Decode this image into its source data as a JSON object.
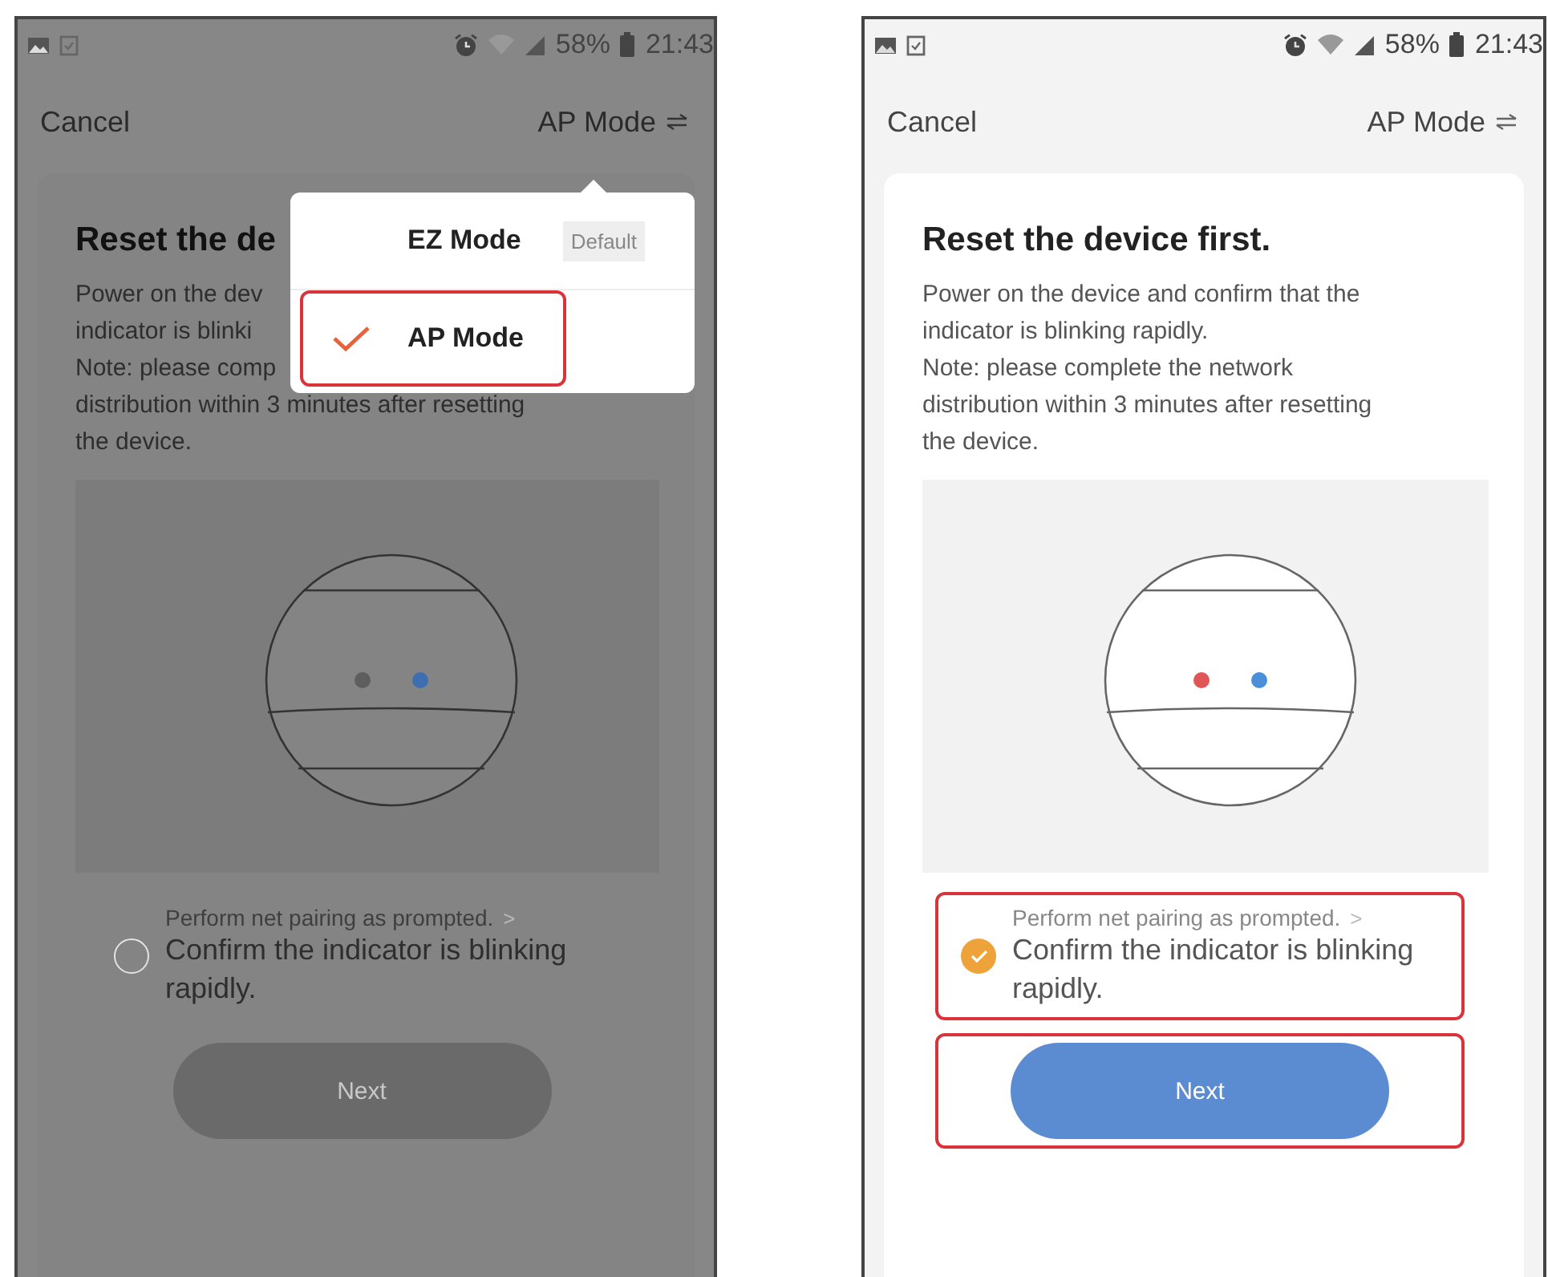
{
  "screens": [
    {
      "dimmed": true,
      "status_bar": {
        "battery": "58%",
        "time": "21:43"
      },
      "nav": {
        "cancel": "Cancel",
        "mode": "AP Mode"
      },
      "card": {
        "title": "Reset the de",
        "lines": [
          "Power on the dev",
          "indicator is blinki",
          "Note: please comp",
          "distribution within 3 minutes after resetting",
          "the device."
        ],
        "indicators": [
          {
            "color": "#5e5e5e"
          },
          {
            "color": "#3d6fb0"
          }
        ],
        "confirm": {
          "hint": "Perform net pairing as prompted.",
          "chevron": ">",
          "label": "Confirm the indicator is blinking rapidly.",
          "checked": false,
          "highlighted": false
        },
        "next": {
          "label": "Next",
          "disabled": true,
          "highlighted": false
        }
      },
      "menu": {
        "items": [
          {
            "label": "EZ Mode",
            "badge": "Default",
            "selected": false,
            "highlighted": false
          },
          {
            "label": "AP Mode",
            "selected": true,
            "highlighted": true
          }
        ]
      }
    },
    {
      "dimmed": false,
      "status_bar": {
        "battery": "58%",
        "time": "21:43"
      },
      "nav": {
        "cancel": "Cancel",
        "mode": "AP Mode"
      },
      "card": {
        "title": "Reset the device first.",
        "lines": [
          "Power on the device and confirm that the",
          "indicator is blinking rapidly.",
          "Note: please complete the network",
          "distribution within 3 minutes after resetting",
          "the device."
        ],
        "indicators": [
          {
            "color": "#e05555"
          },
          {
            "color": "#4a8fd8"
          }
        ],
        "confirm": {
          "hint": "Perform net pairing as prompted.",
          "chevron": ">",
          "label": "Confirm the indicator is blinking rapidly.",
          "checked": true,
          "highlighted": true
        },
        "next": {
          "label": "Next",
          "disabled": false,
          "highlighted": true
        }
      }
    }
  ]
}
